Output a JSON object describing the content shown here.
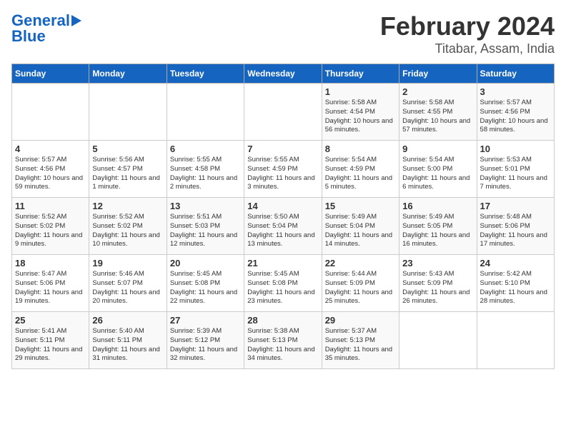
{
  "header": {
    "logo_line1": "General",
    "logo_line2": "Blue",
    "title": "February 2024",
    "subtitle": "Titabar, Assam, India"
  },
  "days_of_week": [
    "Sunday",
    "Monday",
    "Tuesday",
    "Wednesday",
    "Thursday",
    "Friday",
    "Saturday"
  ],
  "weeks": [
    [
      {
        "day": "",
        "info": ""
      },
      {
        "day": "",
        "info": ""
      },
      {
        "day": "",
        "info": ""
      },
      {
        "day": "",
        "info": ""
      },
      {
        "day": "1",
        "info": "Sunrise: 5:58 AM\nSunset: 4:54 PM\nDaylight: 10 hours and 56 minutes."
      },
      {
        "day": "2",
        "info": "Sunrise: 5:58 AM\nSunset: 4:55 PM\nDaylight: 10 hours and 57 minutes."
      },
      {
        "day": "3",
        "info": "Sunrise: 5:57 AM\nSunset: 4:56 PM\nDaylight: 10 hours and 58 minutes."
      }
    ],
    [
      {
        "day": "4",
        "info": "Sunrise: 5:57 AM\nSunset: 4:56 PM\nDaylight: 10 hours and 59 minutes."
      },
      {
        "day": "5",
        "info": "Sunrise: 5:56 AM\nSunset: 4:57 PM\nDaylight: 11 hours and 1 minute."
      },
      {
        "day": "6",
        "info": "Sunrise: 5:55 AM\nSunset: 4:58 PM\nDaylight: 11 hours and 2 minutes."
      },
      {
        "day": "7",
        "info": "Sunrise: 5:55 AM\nSunset: 4:59 PM\nDaylight: 11 hours and 3 minutes."
      },
      {
        "day": "8",
        "info": "Sunrise: 5:54 AM\nSunset: 4:59 PM\nDaylight: 11 hours and 5 minutes."
      },
      {
        "day": "9",
        "info": "Sunrise: 5:54 AM\nSunset: 5:00 PM\nDaylight: 11 hours and 6 minutes."
      },
      {
        "day": "10",
        "info": "Sunrise: 5:53 AM\nSunset: 5:01 PM\nDaylight: 11 hours and 7 minutes."
      }
    ],
    [
      {
        "day": "11",
        "info": "Sunrise: 5:52 AM\nSunset: 5:02 PM\nDaylight: 11 hours and 9 minutes."
      },
      {
        "day": "12",
        "info": "Sunrise: 5:52 AM\nSunset: 5:02 PM\nDaylight: 11 hours and 10 minutes."
      },
      {
        "day": "13",
        "info": "Sunrise: 5:51 AM\nSunset: 5:03 PM\nDaylight: 11 hours and 12 minutes."
      },
      {
        "day": "14",
        "info": "Sunrise: 5:50 AM\nSunset: 5:04 PM\nDaylight: 11 hours and 13 minutes."
      },
      {
        "day": "15",
        "info": "Sunrise: 5:49 AM\nSunset: 5:04 PM\nDaylight: 11 hours and 14 minutes."
      },
      {
        "day": "16",
        "info": "Sunrise: 5:49 AM\nSunset: 5:05 PM\nDaylight: 11 hours and 16 minutes."
      },
      {
        "day": "17",
        "info": "Sunrise: 5:48 AM\nSunset: 5:06 PM\nDaylight: 11 hours and 17 minutes."
      }
    ],
    [
      {
        "day": "18",
        "info": "Sunrise: 5:47 AM\nSunset: 5:06 PM\nDaylight: 11 hours and 19 minutes."
      },
      {
        "day": "19",
        "info": "Sunrise: 5:46 AM\nSunset: 5:07 PM\nDaylight: 11 hours and 20 minutes."
      },
      {
        "day": "20",
        "info": "Sunrise: 5:45 AM\nSunset: 5:08 PM\nDaylight: 11 hours and 22 minutes."
      },
      {
        "day": "21",
        "info": "Sunrise: 5:45 AM\nSunset: 5:08 PM\nDaylight: 11 hours and 23 minutes."
      },
      {
        "day": "22",
        "info": "Sunrise: 5:44 AM\nSunset: 5:09 PM\nDaylight: 11 hours and 25 minutes."
      },
      {
        "day": "23",
        "info": "Sunrise: 5:43 AM\nSunset: 5:09 PM\nDaylight: 11 hours and 26 minutes."
      },
      {
        "day": "24",
        "info": "Sunrise: 5:42 AM\nSunset: 5:10 PM\nDaylight: 11 hours and 28 minutes."
      }
    ],
    [
      {
        "day": "25",
        "info": "Sunrise: 5:41 AM\nSunset: 5:11 PM\nDaylight: 11 hours and 29 minutes."
      },
      {
        "day": "26",
        "info": "Sunrise: 5:40 AM\nSunset: 5:11 PM\nDaylight: 11 hours and 31 minutes."
      },
      {
        "day": "27",
        "info": "Sunrise: 5:39 AM\nSunset: 5:12 PM\nDaylight: 11 hours and 32 minutes."
      },
      {
        "day": "28",
        "info": "Sunrise: 5:38 AM\nSunset: 5:13 PM\nDaylight: 11 hours and 34 minutes."
      },
      {
        "day": "29",
        "info": "Sunrise: 5:37 AM\nSunset: 5:13 PM\nDaylight: 11 hours and 35 minutes."
      },
      {
        "day": "",
        "info": ""
      },
      {
        "day": "",
        "info": ""
      }
    ]
  ]
}
